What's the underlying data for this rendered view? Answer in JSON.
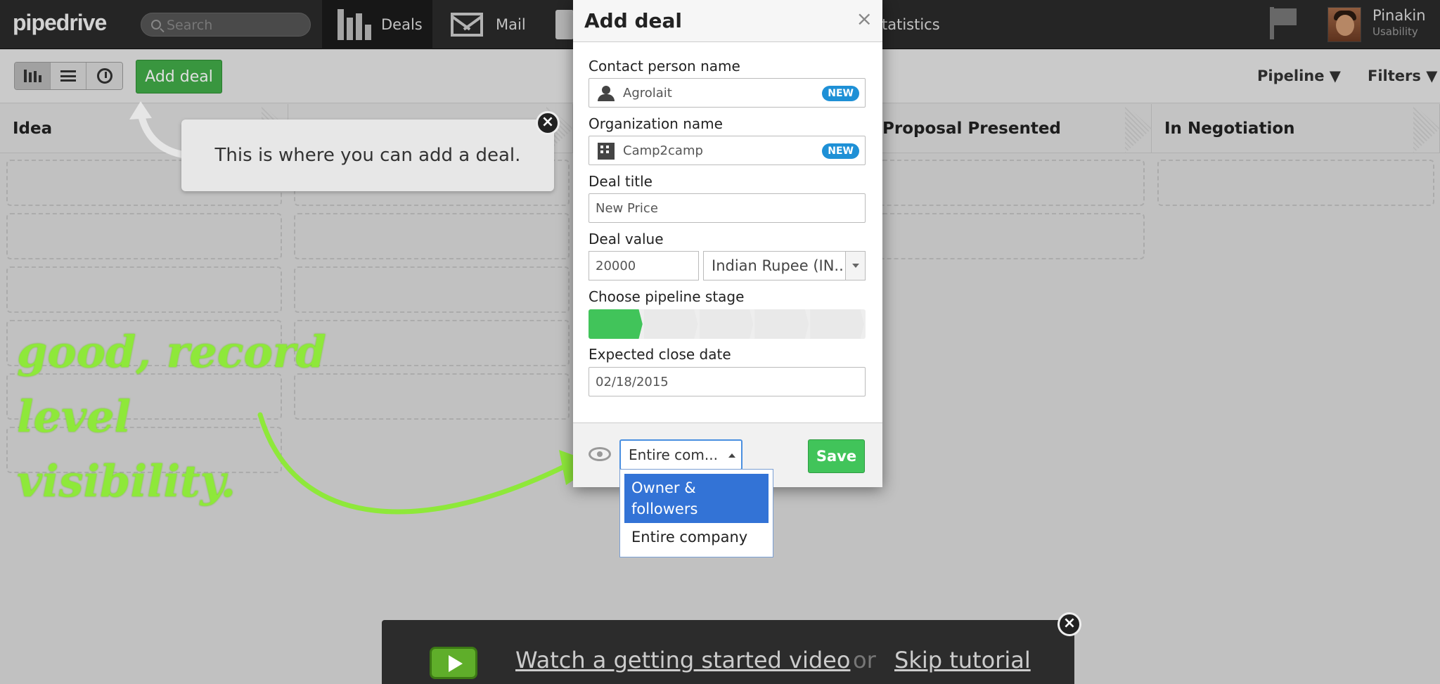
{
  "brand": {
    "logo_text": "pipedrive"
  },
  "topbar": {
    "search_placeholder": "Search",
    "nav": {
      "deals": "Deals",
      "mail": "Mail",
      "statistics": "tatistics"
    },
    "user": {
      "name": "Pinakin",
      "role": "Usability"
    }
  },
  "toolbar": {
    "add_deal": "Add deal",
    "pipeline": "Pipeline ▼",
    "filters": "Filters ▼"
  },
  "board": {
    "stages": [
      "Idea",
      "",
      "Proposal Presented",
      "In Negotiation"
    ]
  },
  "tooltip": {
    "text": "This is where you can add a deal.",
    "close": "×"
  },
  "annotation": {
    "line1": "good, record level",
    "line2": "visibility."
  },
  "modal": {
    "title": "Add deal",
    "close": "×",
    "contact_label": "Contact person name",
    "contact_value": "Agrolait",
    "org_label": "Organization name",
    "org_value": "Camp2camp",
    "new_badge": "NEW",
    "deal_title_label": "Deal title",
    "deal_title_value": "New Price",
    "deal_value_label": "Deal value",
    "deal_value": "20000",
    "currency": "Indian Rupee (IN..",
    "stage_label": "Choose pipeline stage",
    "stage_progress": {
      "selected": 1,
      "total": 5
    },
    "close_date_label": "Expected close date",
    "close_date_value": "02/18/2015",
    "visibility_selected": "Entire com...",
    "visibility_options": [
      "Owner & followers",
      "Entire company"
    ],
    "save": "Save"
  },
  "tutorial": {
    "watch": "Watch a getting started video",
    "or": "or",
    "skip": "Skip tutorial",
    "close": "×"
  },
  "colors": {
    "accent_green": "#41c45a",
    "brand_blue": "#1e90d6",
    "annotation_green": "#8ee83a"
  }
}
